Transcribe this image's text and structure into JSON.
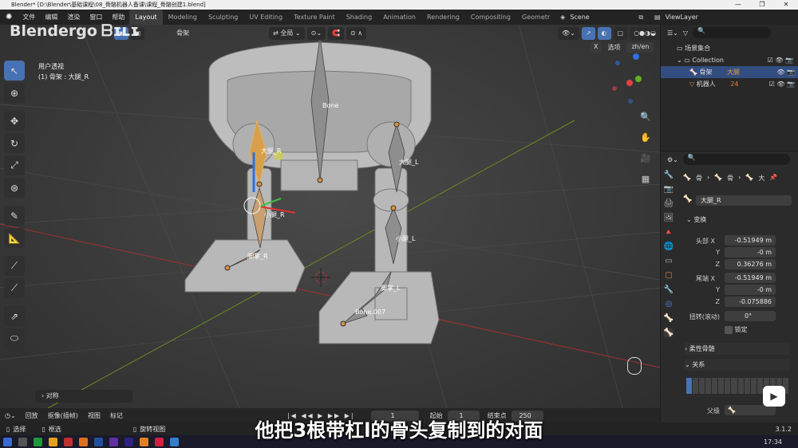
{
  "window": {
    "title": "Blender* [D:\\Blender\\基础课程\\08_骨骼机器人备课\\课程_骨骼创建1.blend]"
  },
  "menubar": {
    "menus": [
      "文件",
      "编辑",
      "渲染",
      "窗口",
      "帮助"
    ],
    "workspaces": [
      "Layout",
      "Modeling",
      "Sculpting",
      "UV Editing",
      "Texture Paint",
      "Shading",
      "Animation",
      "Rendering",
      "Compositing",
      "Geometr"
    ],
    "scene": "Scene",
    "view_layer": "ViewLayer"
  },
  "viewport": {
    "mode_menu": "骨架",
    "transform_orientation": "全局",
    "options_label": "选项",
    "x_label": "X",
    "lang": "zh/en",
    "view_name": "用户透视",
    "selected_info": "(1) 骨架 : 大腿_R",
    "operator_panel": "对称"
  },
  "bone_labels": {
    "bone": "Bone",
    "thigh_l": "大腿_L",
    "calf_l": "小腿_L",
    "foot_l": "脚掌_L",
    "bone007": "Bone.007",
    "thigh_r": "大腿_R",
    "calf_r": "小腿_R",
    "foot_r": "脚掌_R"
  },
  "outliner": {
    "root": "场景集合",
    "collection": "Collection",
    "items": [
      {
        "name": "骨架",
        "tag": "大腿"
      },
      {
        "name": "机器人",
        "tag": "24"
      }
    ]
  },
  "properties": {
    "breadcrumb": [
      "骨",
      "骨",
      "大"
    ],
    "bone_name": "大腿_R",
    "transform_header": "变换",
    "head_label": "头部",
    "tail_label": "尾端",
    "axis_x": "X",
    "axis_y": "Y",
    "axis_z": "Z",
    "head": {
      "x": "-0.51949 m",
      "y": "-0 m",
      "z": "0.36276 m"
    },
    "tail": {
      "x": "-0.51949 m",
      "y": "-0 m",
      "z": "-0.075886"
    },
    "roll_label": "扭转(滚动)",
    "roll": "0°",
    "lock_label": "锁定",
    "bendy_header": "柔性骨骼",
    "relations_header": "关系",
    "parent_label": "父级"
  },
  "timeline": {
    "playback": "回放",
    "keying": "抠像(插帧)",
    "view": "视图",
    "markers": "标记",
    "current_frame": "1",
    "start_label": "起始",
    "start": "1",
    "end_label": "结束点",
    "end": "250"
  },
  "statusbar": {
    "select": "选择",
    "box_select": "框选",
    "rotate_view": "旋转视图",
    "version": "3.1.2"
  },
  "taskbar": {
    "time": "17:34"
  },
  "subtitle": "他把3根带杠l的骨头复制到的对面",
  "watermark": "Blendergo"
}
